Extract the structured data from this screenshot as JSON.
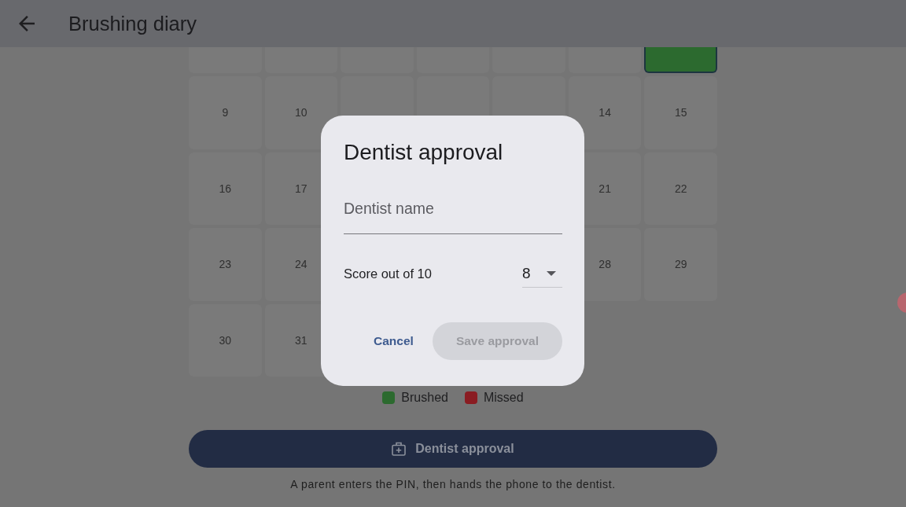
{
  "app_bar": {
    "title": "Brushing diary"
  },
  "calendar": {
    "weeks": [
      {
        "left_days": [
          {
            "kind": "plain",
            "today": false
          },
          {
            "kind": "plain",
            "today": false
          },
          {
            "kind": "plain",
            "today": false
          },
          {
            "kind": "plain",
            "today": false
          },
          {
            "kind": "plain",
            "today": false
          },
          {
            "kind": "plain",
            "today": false
          },
          {
            "kind": "brushed",
            "today": true
          }
        ]
      },
      {
        "left_days": [
          {
            "day": "9",
            "kind": "plain",
            "today": false
          },
          {
            "day": "10",
            "kind": "plain",
            "today": false
          },
          {
            "kind": "plain",
            "today": false
          },
          {
            "kind": "plain",
            "today": false
          },
          {
            "kind": "plain",
            "today": false
          },
          {
            "day": "14",
            "kind": "plain",
            "today": false
          },
          {
            "day": "15",
            "kind": "plain",
            "today": false
          }
        ]
      },
      {
        "left_days": [
          {
            "day": "16",
            "kind": "plain",
            "today": false
          },
          {
            "day": "17",
            "kind": "plain",
            "today": false
          }
        ],
        "right_days": [
          {
            "day": "21",
            "kind": "plain",
            "today": false
          },
          {
            "day": "22",
            "kind": "plain",
            "today": false
          }
        ]
      },
      {
        "left_days": [
          {
            "day": "23",
            "kind": "plain",
            "today": false
          },
          {
            "day": "24",
            "kind": "plain",
            "today": false
          }
        ],
        "right_days": [
          {
            "day": "28",
            "kind": "plain",
            "today": false
          },
          {
            "day": "29",
            "kind": "plain",
            "today": false
          }
        ]
      },
      {
        "left_days": [
          {
            "day": "30",
            "kind": "plain",
            "today": false
          },
          {
            "day": "31",
            "kind": "plain",
            "today": false
          }
        ]
      }
    ]
  },
  "legend": [
    {
      "label": "Brushed",
      "kind": "brushed",
      "color": "#2c6a2f"
    },
    {
      "label": "Missed",
      "kind": "missed",
      "color": "#8a1c22"
    }
  ],
  "approval_button": {
    "label": "Dentist approval"
  },
  "caption": "A parent enters the PIN, then hands the phone to the dentist.",
  "dialog": {
    "title": "Dentist approval",
    "name_field": {
      "placeholder": "Dentist name"
    },
    "score": {
      "label": "Score out of 10",
      "value": "8"
    },
    "actions": [
      {
        "label": "Cancel",
        "kind": "text",
        "disabled": false
      },
      {
        "label": "Save approval",
        "kind": "filled",
        "disabled": true
      }
    ]
  }
}
